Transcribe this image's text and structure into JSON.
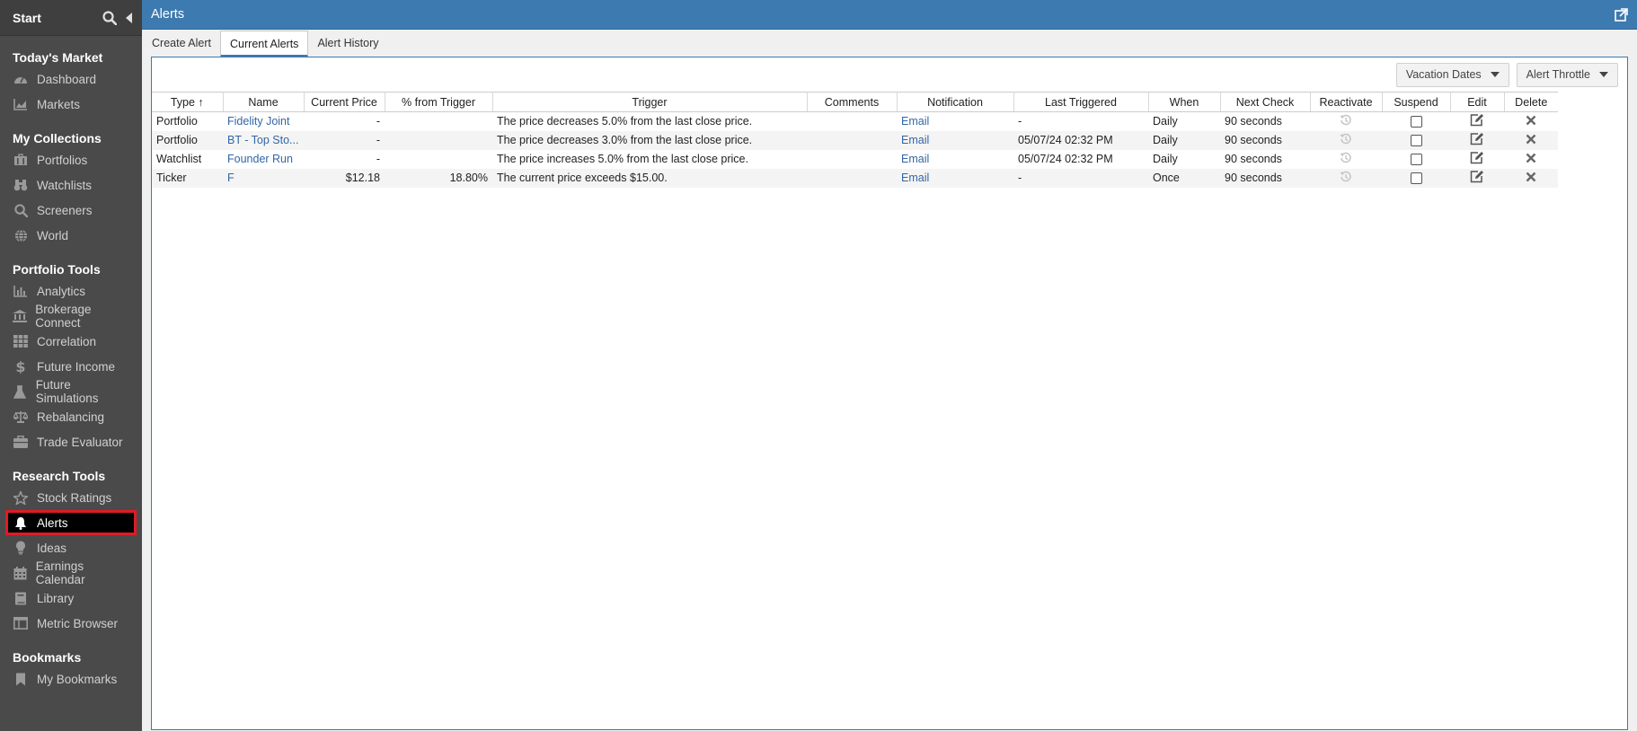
{
  "sidebar": {
    "start_label": "Start",
    "sections": [
      {
        "title": "Today's Market",
        "items": [
          {
            "label": "Dashboard",
            "icon": "dashboard-icon"
          },
          {
            "label": "Markets",
            "icon": "chart-area-icon"
          }
        ]
      },
      {
        "title": "My Collections",
        "items": [
          {
            "label": "Portfolios",
            "icon": "building-icon"
          },
          {
            "label": "Watchlists",
            "icon": "binoculars-icon"
          },
          {
            "label": "Screeners",
            "icon": "search-icon"
          },
          {
            "label": "World",
            "icon": "globe-icon"
          }
        ]
      },
      {
        "title": "Portfolio Tools",
        "items": [
          {
            "label": "Analytics",
            "icon": "bar-chart-icon"
          },
          {
            "label": "Brokerage Connect",
            "icon": "bank-icon"
          },
          {
            "label": "Correlation",
            "icon": "grid-icon"
          },
          {
            "label": "Future Income",
            "icon": "dollar-icon"
          },
          {
            "label": "Future Simulations",
            "icon": "flask-icon"
          },
          {
            "label": "Rebalancing",
            "icon": "scale-icon"
          },
          {
            "label": "Trade Evaluator",
            "icon": "briefcase-icon"
          }
        ]
      },
      {
        "title": "Research Tools",
        "items": [
          {
            "label": "Stock Ratings",
            "icon": "star-icon"
          },
          {
            "label": "Alerts",
            "icon": "bell-icon",
            "active": true
          },
          {
            "label": "Ideas",
            "icon": "lightbulb-icon"
          },
          {
            "label": "Earnings Calendar",
            "icon": "calendar-icon"
          },
          {
            "label": "Library",
            "icon": "book-icon"
          },
          {
            "label": "Metric Browser",
            "icon": "table-icon"
          }
        ]
      },
      {
        "title": "Bookmarks",
        "items": [
          {
            "label": "My Bookmarks",
            "icon": "bookmark-icon"
          }
        ]
      }
    ]
  },
  "header": {
    "title": "Alerts"
  },
  "tabs": [
    {
      "label": "Create Alert",
      "active": false
    },
    {
      "label": "Current Alerts",
      "active": true
    },
    {
      "label": "Alert History",
      "active": false
    }
  ],
  "toolbar": {
    "vacation_label": "Vacation Dates",
    "throttle_label": "Alert Throttle"
  },
  "table": {
    "columns": [
      "Type",
      "Name",
      "Current Price",
      "% from Trigger",
      "Trigger",
      "Comments",
      "Notification",
      "Last Triggered",
      "When",
      "Next Check",
      "Reactivate",
      "Suspend",
      "Edit",
      "Delete"
    ],
    "sort_indicator": "↑",
    "rows": [
      {
        "type": "Portfolio",
        "name": "Fidelity Joint",
        "price": "-",
        "pct": "",
        "trigger": "The price decreases 5.0% from the last close price.",
        "comments": "",
        "notification": "Email",
        "last": "-",
        "when": "Daily",
        "next": "90 seconds"
      },
      {
        "type": "Portfolio",
        "name": "BT - Top Sto...",
        "price": "-",
        "pct": "",
        "trigger": "The price decreases 3.0% from the last close price.",
        "comments": "",
        "notification": "Email",
        "last": "05/07/24 02:32 PM",
        "when": "Daily",
        "next": "90 seconds"
      },
      {
        "type": "Watchlist",
        "name": "Founder Run",
        "price": "-",
        "pct": "",
        "trigger": "The price increases 5.0% from the last close price.",
        "comments": "",
        "notification": "Email",
        "last": "05/07/24 02:32 PM",
        "when": "Daily",
        "next": "90 seconds"
      },
      {
        "type": "Ticker",
        "name": "F",
        "price": "$12.18",
        "pct": "18.80%",
        "trigger": "The current price exceeds $15.00.",
        "comments": "",
        "notification": "Email",
        "last": "-",
        "when": "Once",
        "next": "90 seconds"
      }
    ]
  },
  "colors": {
    "accent": "#3d7ab0",
    "sidebar": "#4a4a4a",
    "link": "#3266a6",
    "highlight": "#e01b24"
  }
}
